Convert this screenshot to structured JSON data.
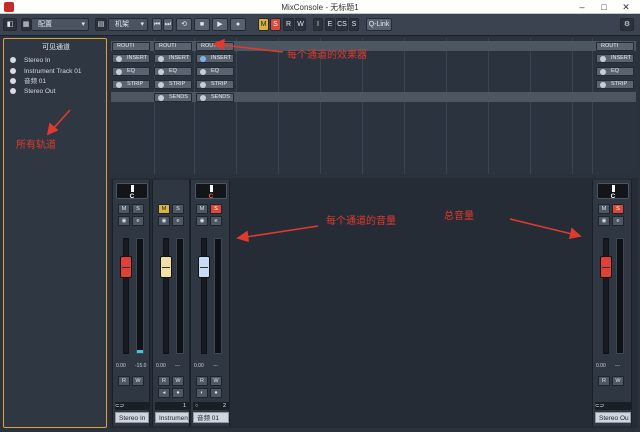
{
  "window": {
    "title": "MixConsole - 无标题1"
  },
  "toolbar": {
    "config_label": "配置",
    "rack_label": "机架",
    "m_label": "M",
    "s_label": "S",
    "r_label": "R",
    "w_label": "W",
    "i_label": "I",
    "e_label": "E",
    "cs_label": "CS",
    "s2_label": "S",
    "qlink_label": "Q-Link"
  },
  "left_panel": {
    "title": "可见通道",
    "tracks": [
      "Stereo In",
      "Instrument Track 01",
      "音频 01",
      "Stereo Out"
    ]
  },
  "rack": {
    "routing_label": "ROUTI",
    "insert_label": "INSERT",
    "eq_label": "EQ",
    "strip_label": "STRIP",
    "sends_label": "SENDS"
  },
  "mixer": {
    "pan_label": "C",
    "m": "M",
    "s": "S",
    "r": "R",
    "w": "W",
    "fader_value": "0.00",
    "meter_peak": "-15.0",
    "dash": "---",
    "channels": [
      {
        "name": "Stereo In",
        "num": ""
      },
      {
        "name": "Instrumen",
        "num": "1"
      },
      {
        "name": "音频 01",
        "num": "2"
      }
    ],
    "master": {
      "name": "Stereo Ou"
    }
  },
  "annotations": {
    "rack_note": "每个通道的效果器",
    "tracks_note": "所有轨道",
    "volume_note": "每个通道的音量",
    "master_note": "总音量"
  },
  "colors": {
    "accent_orange": "#e0a13c",
    "mute_yellow": "#dcb240",
    "solo_red": "#d9493a",
    "annotation_red": "#e03a2e"
  }
}
